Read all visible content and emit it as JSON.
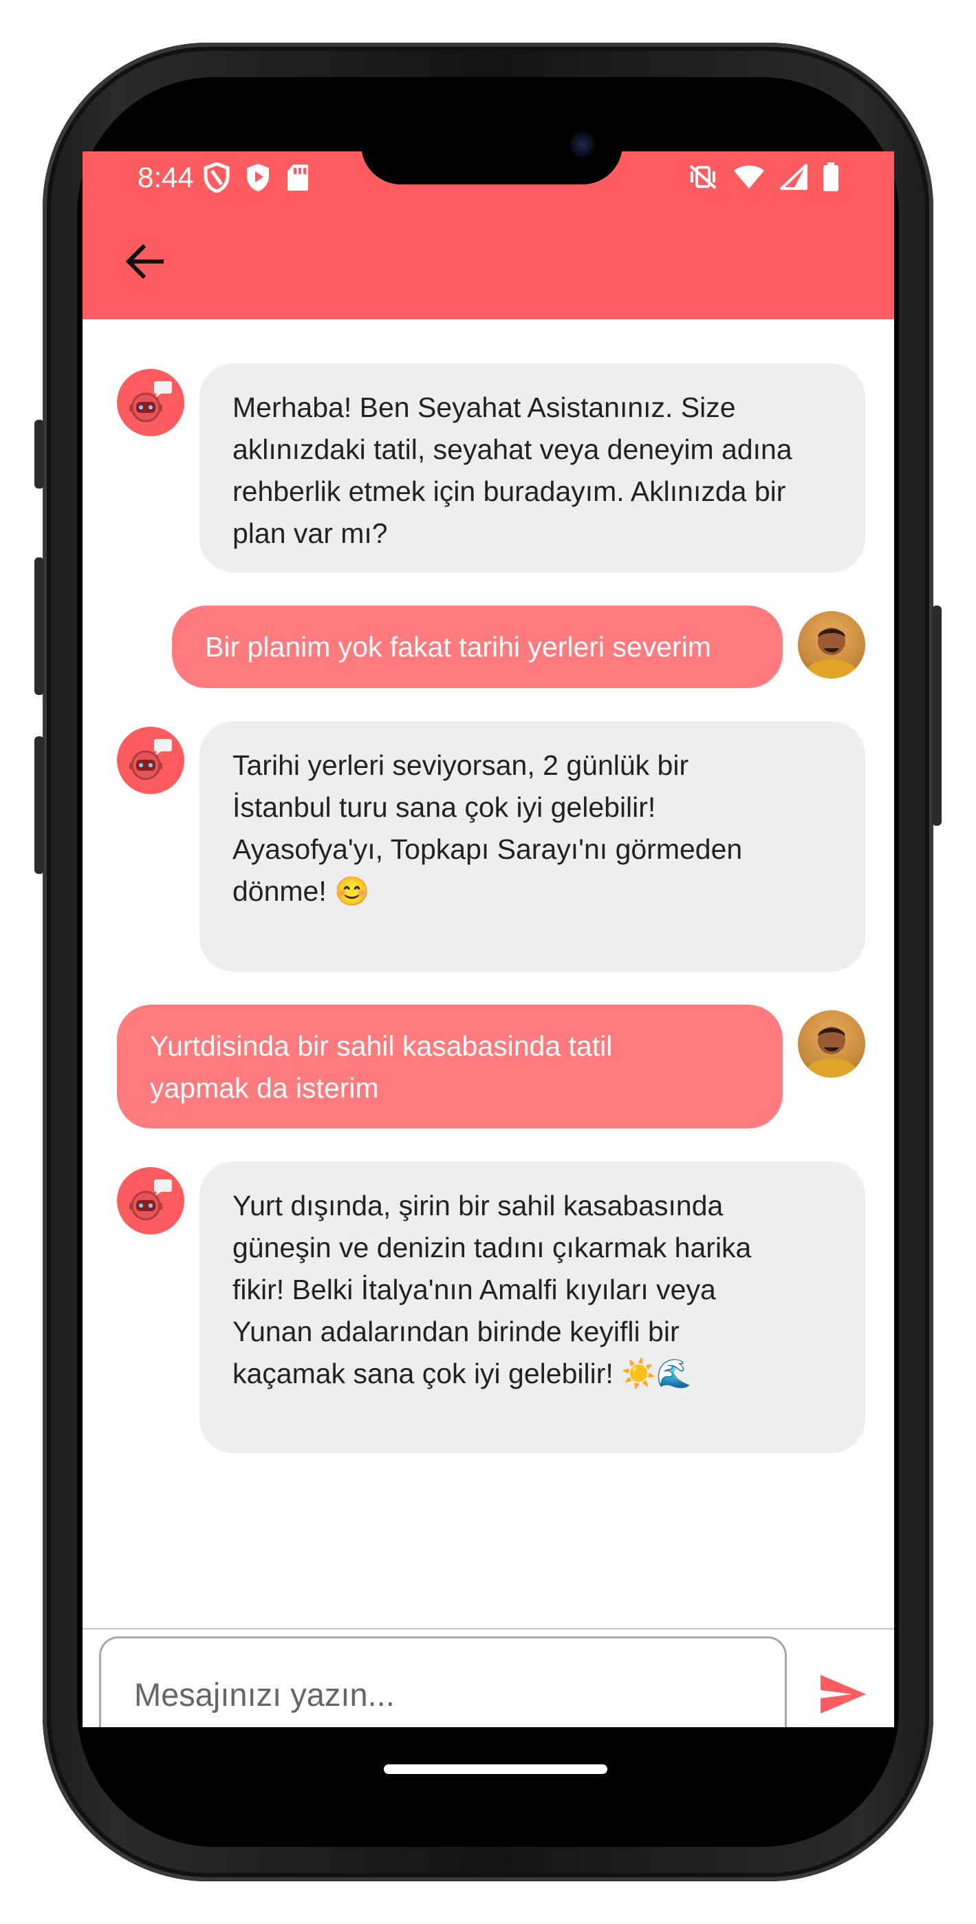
{
  "status_bar": {
    "time": "8:44",
    "left_icons": [
      "shield-icon",
      "play-protect-icon",
      "sd-card-icon"
    ],
    "right_icons": [
      "vibrate-off-icon",
      "wifi-icon",
      "cellular-icon",
      "battery-icon"
    ]
  },
  "appbar": {
    "back_icon": "arrow-left-icon",
    "color": "#ff5c5f"
  },
  "messages": [
    {
      "sender": "bot",
      "text": "Merhaba! Ben Seyahat Asistanınız. Size\naklınızdaki tatil, seyahat veya deneyim adına\nrehberlik etmek için buradayım. Aklınızda bir\nplan var mı?"
    },
    {
      "sender": "user",
      "text": "Bir planim yok fakat tarihi yerleri severim"
    },
    {
      "sender": "bot",
      "text": "Tarihi yerleri seviyorsan, 2 günlük bir\nİstanbul turu sana çok iyi gelebilir!\nAyasofya'yı, Topkapı Sarayı'nı görmeden\ndönme! 😊"
    },
    {
      "sender": "user",
      "text": "Yurtdisinda bir sahil kasabasinda tatil\nyapmak da isterim"
    },
    {
      "sender": "bot",
      "text": "Yurt dışında, şirin bir sahil kasabasında\ngüneşin ve denizin tadını çıkarmak harika\nfikir! Belki İtalya'nın Amalfi kıyıları veya\nYunan adalarından birinde keyifli bir\nkaçamak sana çok iyi gelebilir! ☀️🌊"
    }
  ],
  "input": {
    "placeholder": "Mesajınızı yazın...",
    "value": ""
  },
  "send_icon": "send-icon",
  "colors": {
    "accent": "#ff5c5f",
    "user_bubble": "#ff7b7e",
    "bot_bubble": "#eeeeee"
  }
}
